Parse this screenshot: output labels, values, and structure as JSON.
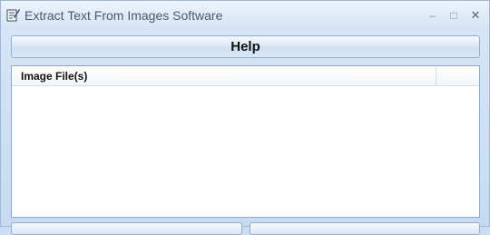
{
  "window": {
    "title": "Extract Text From Images Software",
    "controls": {
      "minimize": "–",
      "maximize": "□",
      "close": "✕"
    }
  },
  "toolbar": {
    "help_label": "Help"
  },
  "file_list": {
    "columns": [
      "Image File(s)"
    ],
    "rows": []
  },
  "icons": {
    "app": "notepad-pencil-icon"
  },
  "colors": {
    "background": "#c6daf1",
    "accent_border": "#93aecd"
  }
}
